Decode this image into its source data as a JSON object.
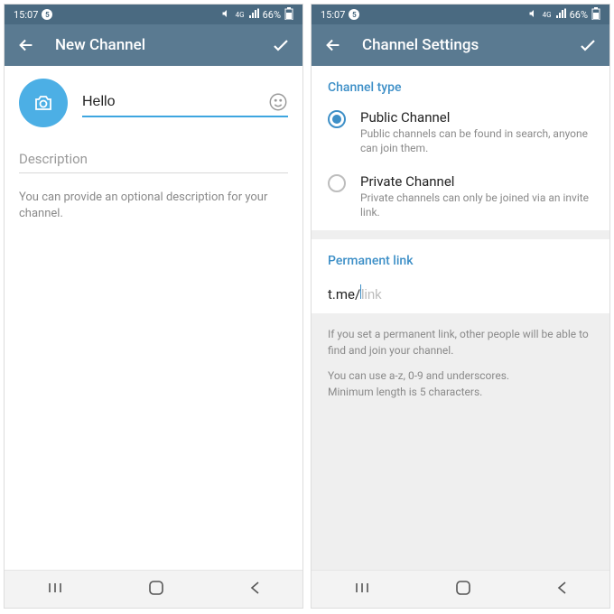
{
  "status": {
    "time": "15:07",
    "notif_count": "5",
    "battery": "66%"
  },
  "left": {
    "appbar": {
      "title": "New Channel"
    },
    "channel_name": "Hello",
    "desc_label": "Description",
    "desc_hint": "You can provide an optional description for your channel."
  },
  "right": {
    "appbar": {
      "title": "Channel Settings"
    },
    "channel_type_header": "Channel type",
    "options": [
      {
        "title": "Public Channel",
        "sub": "Public channels can be found in search, anyone can join them."
      },
      {
        "title": "Private Channel",
        "sub": "Private channels can only be joined via an invite link."
      }
    ],
    "permalink_header": "Permanent link",
    "permalink_prefix": "t.me/",
    "permalink_placeholder": "link",
    "info1": "If you set a permanent link, other people will be able to find and join your channel.",
    "info2": "You can use a-z, 0-9 and underscores.",
    "info3": "Minimum length is 5 characters."
  }
}
